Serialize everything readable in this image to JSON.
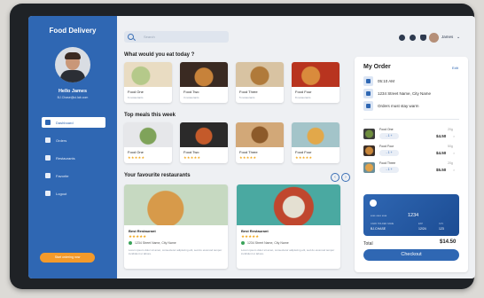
{
  "app": {
    "title": "Food Delivery"
  },
  "profile": {
    "greeting": "Hello James",
    "email": "BJ.Chase@ui.lab.com"
  },
  "nav": [
    {
      "label": "Dashboard",
      "icon": "grid-icon",
      "active": true
    },
    {
      "label": "Orders",
      "icon": "list-icon"
    },
    {
      "label": "Restaurants",
      "icon": "store-icon"
    },
    {
      "label": "Favorite",
      "icon": "heart-icon"
    },
    {
      "label": "Logout",
      "icon": "logout-icon"
    }
  ],
  "sidebar_button": "Start ordering now",
  "search": {
    "placeholder": "Search"
  },
  "header": {
    "user_name": "James"
  },
  "sections": {
    "today": "What would you eat today ?",
    "top": "Top meals this week",
    "restaurants": "Your favourite restaurants"
  },
  "today_cards": [
    {
      "name": "Food One",
      "sub": "6 restaurants"
    },
    {
      "name": "Food Two",
      "sub": "3 restaurants"
    },
    {
      "name": "Food Three",
      "sub": "5 restaurants"
    },
    {
      "name": "Food Four",
      "sub": "8 restaurants"
    }
  ],
  "top_cards": [
    {
      "name": "Food One",
      "stars": "★★★★★"
    },
    {
      "name": "Food Two",
      "stars": "★★★★★"
    },
    {
      "name": "Food Three",
      "stars": "★★★★★"
    },
    {
      "name": "Food Four",
      "stars": "★★★★★"
    }
  ],
  "restaurants": [
    {
      "name": "Best Restaurant",
      "stars": "★★★★★",
      "address": "1234 Street Name, City Name",
      "desc": "Lorem ipsum dolor sit amet, consectetur adipiscing elit, sed do eiusmod tempor incididunt ut labore."
    },
    {
      "name": "Best Restaurant",
      "stars": "★★★★★",
      "address": "1234 Street Name, City Name",
      "desc": "Lorem ipsum dolor sit amet, consectetur adipiscing elit, sed do eiusmod tempor incididunt ut labore."
    }
  ],
  "order": {
    "title": "My Order",
    "edit": "Edit",
    "time": "05:10 AM",
    "address": "1234 Street Name, City Name",
    "note": "Orders must stay warm",
    "items": [
      {
        "name": "Food One",
        "qty": "20g",
        "ctrl": "- 1 +",
        "price": "$4.50"
      },
      {
        "name": "Food Four",
        "qty": "50g",
        "ctrl": "- 1 +",
        "price": "$4.50"
      },
      {
        "name": "Food Three",
        "qty": "20g",
        "ctrl": "- 1 +",
        "price": "$5.50"
      }
    ],
    "card": {
      "number": "1234",
      "masked": "**** **** ****",
      "label1": "CARD HOLDER NAME",
      "val1": "BJ.CHASE",
      "label2": "EXP",
      "val2": "12/24",
      "label3": "CVV",
      "val3": "123"
    },
    "total_label": "Total",
    "total": "$14.50",
    "checkout": "Checkout"
  }
}
